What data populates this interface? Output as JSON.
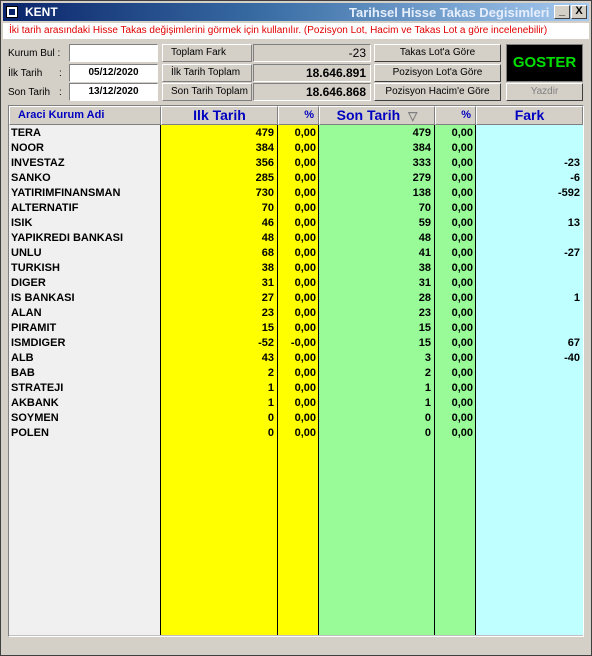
{
  "window": {
    "app_name": "KENT",
    "title": "Tarihsel Hisse Takas Degisimleri",
    "min_glyph": "_",
    "close_glyph": "X"
  },
  "info_text": "İki tarih arasındaki Hisse Takas değişimlerini görmek için kullanılır. (Pozisyon Lot, Hacim ve Takas Lot a göre incelenebilir)",
  "form": {
    "kurum_bul_label": "Kurum Bul :",
    "kurum_bul_value": "",
    "ilk_tarih_label": "İlk Tarih",
    "ilk_tarih_value": "05/12/2020",
    "son_tarih_label": "Son Tarih",
    "colon": ":",
    "son_tarih_value": "13/12/2020"
  },
  "summary": {
    "toplam_fark_label": "Toplam Fark",
    "toplam_fark_value": "-23",
    "ilk_toplam_label": "İlk Tarih Toplam",
    "ilk_toplam_value": "18.646.891",
    "son_toplam_label": "Son Tarih Toplam",
    "son_toplam_value": "18.646.868"
  },
  "buttons": {
    "takas_lot": "Takas Lot'a Göre",
    "pozisyon_lot": "Pozisyon Lot'a Göre",
    "pozisyon_hacim": "Pozisyon Hacim'e Göre",
    "goster": "GOSTER",
    "yazdir": "Yazdir"
  },
  "headers": {
    "kurum": "Araci Kurum Adi",
    "ilk": "Ilk Tarih",
    "pct1": "%",
    "son": "Son Tarih",
    "sort_glyph": "▽",
    "pct2": "%",
    "fark": "Fark"
  },
  "colors": {
    "yellow": "#ffff00",
    "green": "#98fb98",
    "cyan": "#c0ffff",
    "goster_bg": "#000000",
    "goster_fg": "#00e000",
    "info_red": "#e00000",
    "header_blue": "#0000c0"
  },
  "rows": [
    {
      "name": "TERA",
      "ilk": "479",
      "p1": "0,00",
      "son": "479",
      "p2": "0,00",
      "fark": ""
    },
    {
      "name": "NOOR",
      "ilk": "384",
      "p1": "0,00",
      "son": "384",
      "p2": "0,00",
      "fark": ""
    },
    {
      "name": "INVESTAZ",
      "ilk": "356",
      "p1": "0,00",
      "son": "333",
      "p2": "0,00",
      "fark": "-23"
    },
    {
      "name": "SANKO",
      "ilk": "285",
      "p1": "0,00",
      "son": "279",
      "p2": "0,00",
      "fark": "-6"
    },
    {
      "name": "YATIRIMFINANSMAN",
      "ilk": "730",
      "p1": "0,00",
      "son": "138",
      "p2": "0,00",
      "fark": "-592"
    },
    {
      "name": "ALTERNATIF",
      "ilk": "70",
      "p1": "0,00",
      "son": "70",
      "p2": "0,00",
      "fark": ""
    },
    {
      "name": "ISIK",
      "ilk": "46",
      "p1": "0,00",
      "son": "59",
      "p2": "0,00",
      "fark": "13"
    },
    {
      "name": "YAPIKREDI BANKASI",
      "ilk": "48",
      "p1": "0,00",
      "son": "48",
      "p2": "0,00",
      "fark": ""
    },
    {
      "name": "UNLU",
      "ilk": "68",
      "p1": "0,00",
      "son": "41",
      "p2": "0,00",
      "fark": "-27"
    },
    {
      "name": "TURKISH",
      "ilk": "38",
      "p1": "0,00",
      "son": "38",
      "p2": "0,00",
      "fark": ""
    },
    {
      "name": "DIGER",
      "ilk": "31",
      "p1": "0,00",
      "son": "31",
      "p2": "0,00",
      "fark": ""
    },
    {
      "name": "IS BANKASI",
      "ilk": "27",
      "p1": "0,00",
      "son": "28",
      "p2": "0,00",
      "fark": "1"
    },
    {
      "name": "ALAN",
      "ilk": "23",
      "p1": "0,00",
      "son": "23",
      "p2": "0,00",
      "fark": ""
    },
    {
      "name": "PIRAMIT",
      "ilk": "15",
      "p1": "0,00",
      "son": "15",
      "p2": "0,00",
      "fark": ""
    },
    {
      "name": "ISMDIGER",
      "ilk": "-52",
      "p1": "-0,00",
      "son": "15",
      "p2": "0,00",
      "fark": "67"
    },
    {
      "name": "ALB",
      "ilk": "43",
      "p1": "0,00",
      "son": "3",
      "p2": "0,00",
      "fark": "-40"
    },
    {
      "name": "BAB",
      "ilk": "2",
      "p1": "0,00",
      "son": "2",
      "p2": "0,00",
      "fark": ""
    },
    {
      "name": "STRATEJI",
      "ilk": "1",
      "p1": "0,00",
      "son": "1",
      "p2": "0,00",
      "fark": ""
    },
    {
      "name": "AKBANK",
      "ilk": "1",
      "p1": "0,00",
      "son": "1",
      "p2": "0,00",
      "fark": ""
    },
    {
      "name": "SOYMEN",
      "ilk": "0",
      "p1": "0,00",
      "son": "0",
      "p2": "0,00",
      "fark": ""
    },
    {
      "name": "POLEN",
      "ilk": "0",
      "p1": "0,00",
      "son": "0",
      "p2": "0,00",
      "fark": ""
    }
  ]
}
